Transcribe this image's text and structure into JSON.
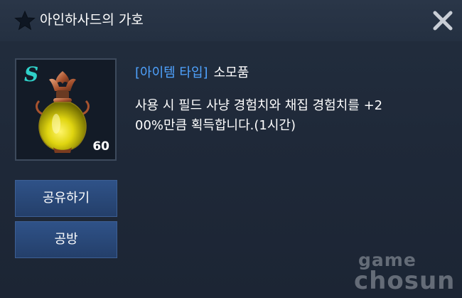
{
  "window": {
    "title": "아인하사드의 가호",
    "title_icon": "star-icon",
    "close_icon": "close-icon"
  },
  "item": {
    "grade": "S",
    "count": "60",
    "icon": "potion-icon",
    "type_label": "[아이템 타입]",
    "type_value": "소모품",
    "description_line1": "사용 시 필드 사냥 경험치와 채집 경험치를 +2",
    "description_line2": "00%만큼 획득합니다.(1시간)"
  },
  "actions": {
    "share_label": "공유하기",
    "guild_label": "공방"
  },
  "watermark": {
    "top": "game",
    "bottom": "chosun"
  },
  "colors": {
    "background": "#1f2939",
    "grade_color": "#2fd0c8",
    "type_label_color": "#4fa3ff",
    "button_color": "#2f5288"
  }
}
